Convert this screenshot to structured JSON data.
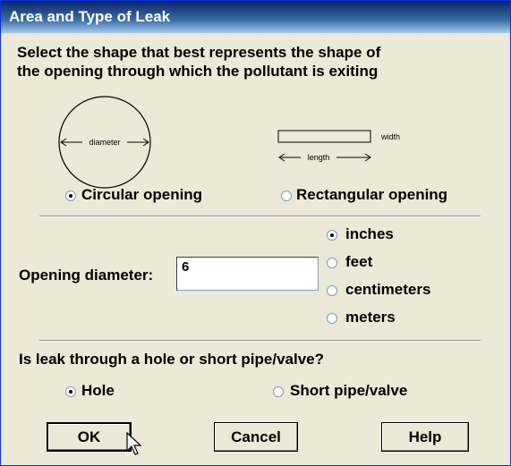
{
  "window": {
    "title": "Area and Type of Leak"
  },
  "instructions": "Select the shape that best represents the shape of\nthe opening through which the pollutant is exiting",
  "diagrams": {
    "circle_label": "diameter",
    "rect_width_label": "width",
    "rect_length_label": "length"
  },
  "shape_options": [
    {
      "label": "Circular opening",
      "selected": true
    },
    {
      "label": "Rectangular opening",
      "selected": false
    }
  ],
  "opening": {
    "label": "Opening diameter:",
    "value": "6"
  },
  "units": [
    {
      "label": "inches",
      "selected": true
    },
    {
      "label": "feet",
      "selected": false
    },
    {
      "label": "centimeters",
      "selected": false
    },
    {
      "label": "meters",
      "selected": false
    }
  ],
  "leak": {
    "question": "Is leak through a hole or short pipe/valve?",
    "options": [
      {
        "label": "Hole",
        "selected": true
      },
      {
        "label": "Short pipe/valve",
        "selected": false
      }
    ]
  },
  "buttons": {
    "ok": "OK",
    "cancel": "Cancel",
    "help": "Help"
  }
}
